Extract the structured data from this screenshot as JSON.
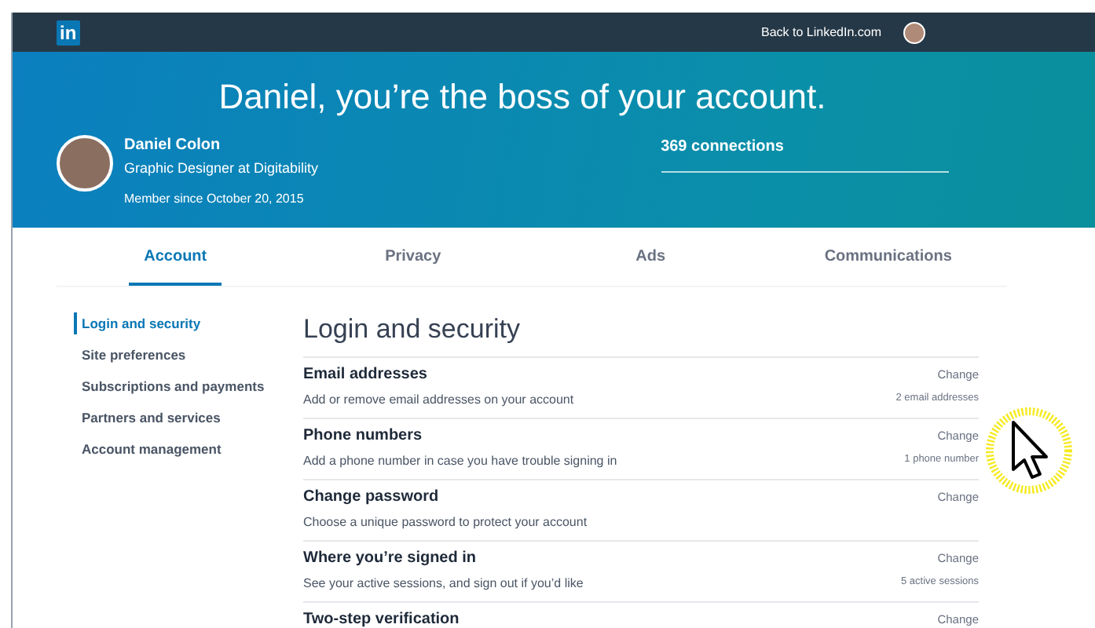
{
  "topbar": {
    "logo": "in",
    "back_link": "Back to LinkedIn.com"
  },
  "hero": {
    "headline": "Daniel, you’re the boss of your account.",
    "name": "Daniel Colon",
    "job_title": "Graphic Designer at Digitability",
    "member_since": "Member since October 20, 2015",
    "connections": "369 connections"
  },
  "tabs": [
    {
      "label": "Account",
      "selected": true
    },
    {
      "label": "Privacy",
      "selected": false
    },
    {
      "label": "Ads",
      "selected": false
    },
    {
      "label": "Communications",
      "selected": false
    }
  ],
  "sidebar": {
    "items": [
      {
        "label": "Login and security",
        "selected": true
      },
      {
        "label": "Site preferences",
        "selected": false
      },
      {
        "label": "Subscriptions and payments",
        "selected": false
      },
      {
        "label": "Partners and services",
        "selected": false
      },
      {
        "label": "Account management",
        "selected": false
      }
    ]
  },
  "section": {
    "title": "Login and security",
    "rows": [
      {
        "title": "Email addresses",
        "description": "Add or remove email addresses on your account",
        "action": "Change",
        "detail": "2 email addresses"
      },
      {
        "title": "Phone numbers",
        "description": "Add a phone number in case you have trouble signing in",
        "action": "Change",
        "detail": "1 phone number"
      },
      {
        "title": "Change password",
        "description": "Choose a unique password to protect your account",
        "action": "Change"
      },
      {
        "title": "Where you’re signed in",
        "description": "See your active sessions, and sign out if you’d like",
        "action": "Change",
        "detail": "5 active sessions"
      },
      {
        "title": "Two-step verification",
        "action": "Change"
      }
    ]
  }
}
